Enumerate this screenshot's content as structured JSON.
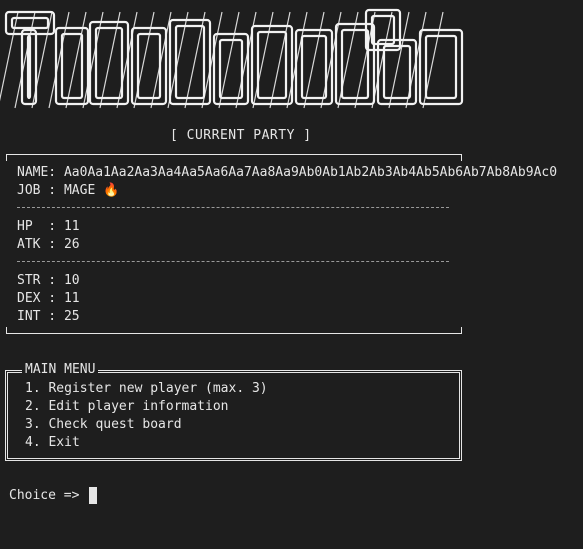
{
  "party": {
    "title": "[ CURRENT PARTY ]",
    "name_label": "NAME: ",
    "name_value": "Aa0Aa1Aa2Aa3Aa4Aa5Aa6Aa7Aa8Aa9Ab0Ab1Ab2Ab3Ab4Ab5Ab6Ab7Ab8Ab9Ac0",
    "job_label": "JOB : ",
    "job_value": "MAGE",
    "job_icon": "fire-icon",
    "hp_label": "HP  : ",
    "hp_value": "11",
    "atk_label": "ATK : ",
    "atk_value": "26",
    "str_label": "STR : ",
    "str_value": "10",
    "dex_label": "DEX : ",
    "dex_value": "11",
    "int_label": "INT : ",
    "int_value": "25"
  },
  "menu": {
    "title": "MAIN MENU",
    "items": [
      "1. Register new player (max. 3)",
      "2. Edit player information",
      "3. Check quest board",
      "4. Exit"
    ]
  },
  "prompt": {
    "label": "Choice => "
  },
  "colors": {
    "background": "#1e1e1e",
    "foreground": "#e6e6e6",
    "fire": "#ff8a1e"
  }
}
